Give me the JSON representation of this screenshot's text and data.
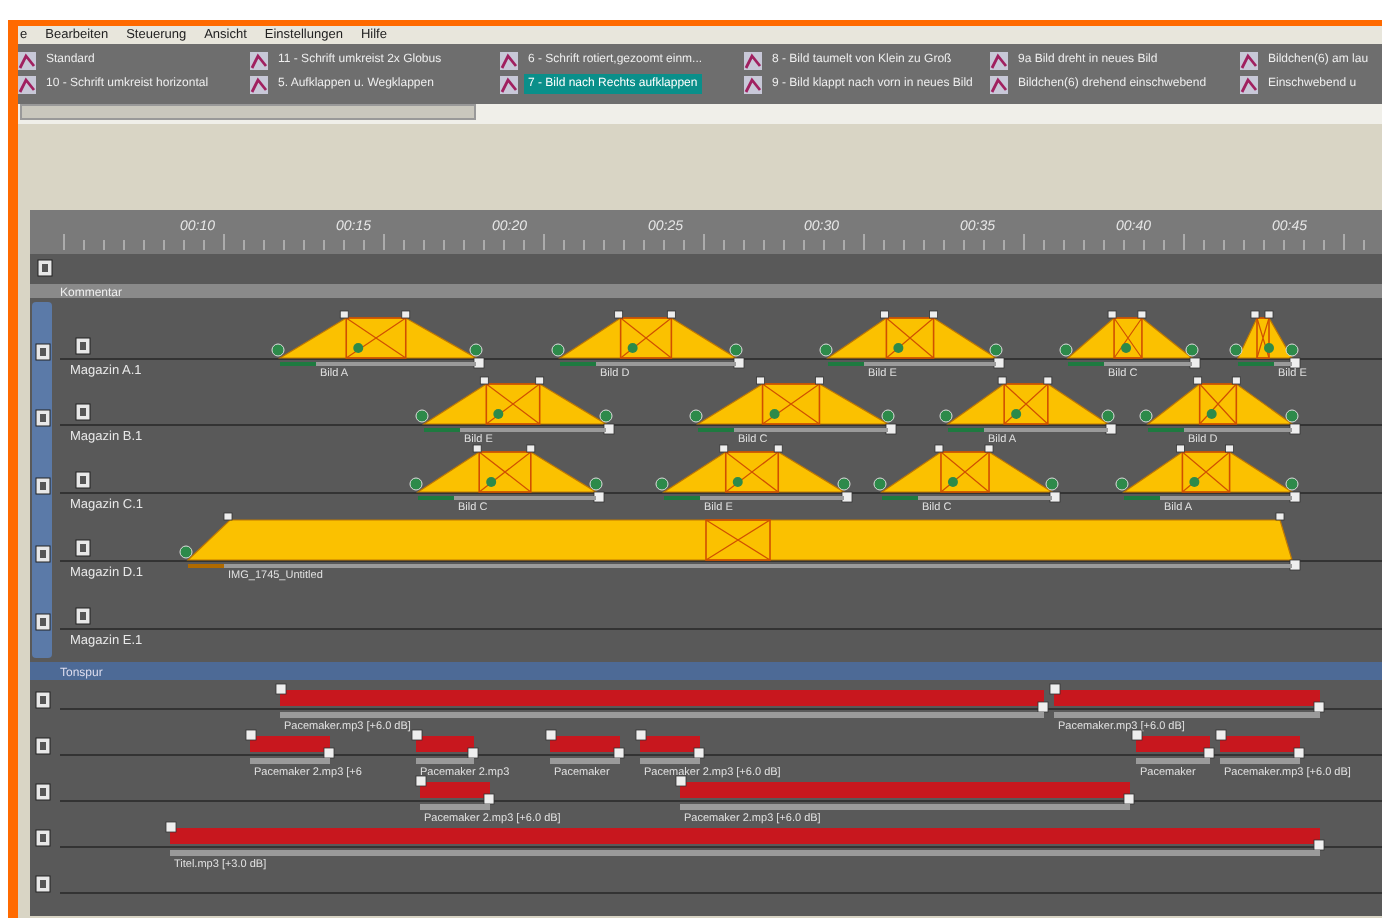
{
  "menu": [
    {
      "label": "e"
    },
    {
      "label": "Bearbeiten"
    },
    {
      "label": "Steuerung"
    },
    {
      "label": "Ansicht"
    },
    {
      "label": "Einstellungen"
    },
    {
      "label": "Hilfe"
    }
  ],
  "presets": [
    {
      "label": "Standard",
      "selected": false
    },
    {
      "label": "11 - Schrift umkreist 2x Globus",
      "selected": false
    },
    {
      "label": "6 - Schrift rotiert,gezoomt einm...",
      "selected": false
    },
    {
      "label": "8 - Bild taumelt von Klein zu Groß",
      "selected": false
    },
    {
      "label": "9a Bild dreht in neues Bild",
      "selected": false
    },
    {
      "label": "Bildchen(6) am lau",
      "selected": false
    },
    {
      "label": "10 - Schrift umkreist horizontal",
      "selected": false
    },
    {
      "label": "5. Aufklappen u. Wegklappen",
      "selected": false
    },
    {
      "label": "7 - Bild nach Rechts aufklappen",
      "selected": true
    },
    {
      "label": "9 - Bild klappt nach vorn in neues Bild",
      "selected": false
    },
    {
      "label": "Bildchen(6) drehend einschwebend",
      "selected": false
    },
    {
      "label": "Einschwebend u",
      "selected": false
    }
  ],
  "timeline": {
    "ruler": [
      "00:10",
      "00:15",
      "00:20",
      "00:25",
      "00:30",
      "00:35",
      "00:40",
      "00:45"
    ],
    "comment_track": {
      "label": "Kommentar"
    },
    "image_tracks": [
      {
        "label": "Magazin A.1",
        "clips": [
          {
            "label": "Bild A"
          },
          {
            "label": "Bild D"
          },
          {
            "label": "Bild E"
          },
          {
            "label": "Bild C"
          },
          {
            "label": "Bild E"
          }
        ]
      },
      {
        "label": "Magazin B.1",
        "clips": [
          {
            "label": "Bild E"
          },
          {
            "label": "Bild C"
          },
          {
            "label": "Bild A"
          },
          {
            "label": "Bild D"
          }
        ]
      },
      {
        "label": "Magazin C.1",
        "clips": [
          {
            "label": "Bild C"
          },
          {
            "label": "Bild E"
          },
          {
            "label": "Bild C"
          },
          {
            "label": "Bild A"
          }
        ]
      },
      {
        "label": "Magazin D.1",
        "clips": [
          {
            "label": "IMG_1745_Untitled"
          }
        ]
      },
      {
        "label": "Magazin E.1"
      }
    ],
    "audio_section": {
      "label": "Tonspur"
    },
    "audio_tracks": [
      {
        "clips": [
          {
            "label": "Pacemaker.mp3 [+6.0 dB]"
          },
          {
            "label": "Pacemaker.mp3 [+6.0 dB]"
          }
        ]
      },
      {
        "clips": [
          {
            "label": "Pacemaker 2.mp3 [+6"
          },
          {
            "label": "Pacemaker 2.mp3"
          },
          {
            "label": "Pacemaker"
          },
          {
            "label": "Pacemaker 2.mp3 [+6.0 dB]"
          },
          {
            "label": "Pacemaker"
          },
          {
            "label": "Pacemaker.mp3 [+6.0 dB]"
          }
        ]
      },
      {
        "clips": [
          {
            "label": "Pacemaker 2.mp3 [+6.0 dB]"
          },
          {
            "label": "Pacemaker 2.mp3 [+6.0 dB]"
          }
        ]
      },
      {
        "clips": [
          {
            "label": "Titel.mp3 [+3.0 dB]"
          }
        ]
      }
    ]
  }
}
